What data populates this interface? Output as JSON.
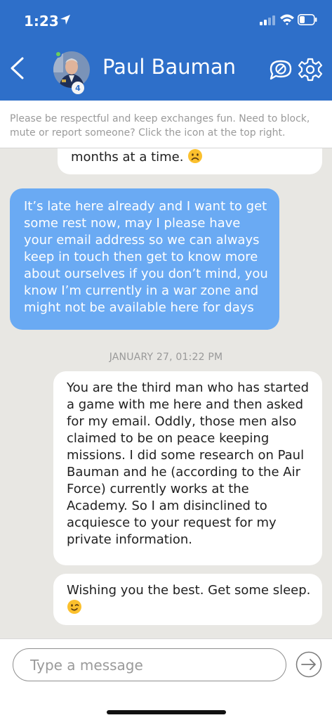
{
  "status_bar": {
    "time": "1:23"
  },
  "header": {
    "title": "Paul Bauman",
    "avatar_badge": "4",
    "accent_color": "#2e6fc9",
    "icons": {
      "back": "chevron-left-icon",
      "report": "report-bubble-icon",
      "settings": "gear-icon"
    }
  },
  "notice": {
    "text": "Please be respectful and keep exchanges fun. Need to block, mute or report someone? Click the icon at the top right."
  },
  "messages": [
    {
      "direction": "in",
      "text": "months at a time.",
      "emoji": "frowning-face"
    },
    {
      "direction": "out",
      "text": "It’s late here already and I want to get some rest now, may I please have your email address so we can always keep in touch then get to know more about ourselves if you don’t mind, you know I’m currently in a war zone and might not be available here for days"
    },
    {
      "direction": "in",
      "text": "You are the third man who has started a game with me here and then asked for my email. Oddly, those men also claimed to be on peace keeping missions. I did some research on Paul Bauman and he (according to the Air Force) currently works at the Academy. So I am disinclined to acquiesce to your request for my private information."
    },
    {
      "direction": "in",
      "text": "Wishing you the best. Get some sleep.",
      "emoji": "winking-face"
    }
  ],
  "date_divider": "JANUARY 27, 01:22 PM",
  "composer": {
    "placeholder": "Type a message",
    "value": ""
  }
}
